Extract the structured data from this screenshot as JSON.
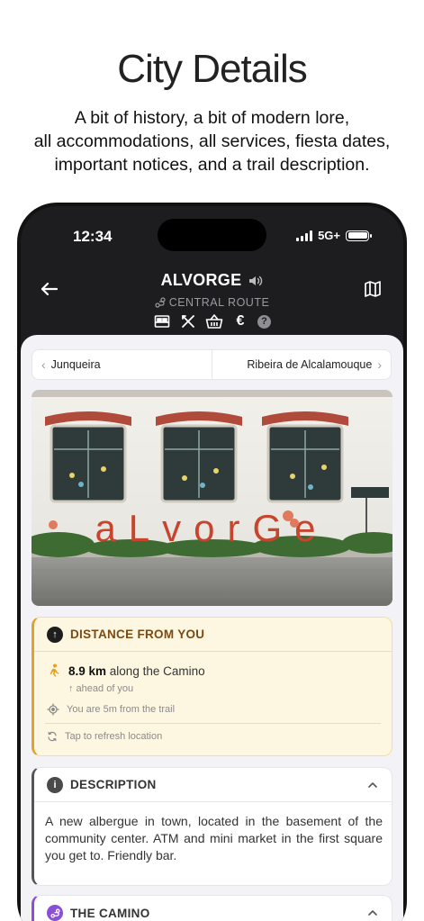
{
  "hero": {
    "title": "City Details",
    "subtitle_lines": [
      "A bit of history, a bit of modern lore,",
      "all accommodations, all services, fiesta dates,",
      "important notices, and a trail description."
    ]
  },
  "status_bar": {
    "time": "12:34",
    "network": "5G+"
  },
  "header": {
    "city_name": "ALVORGE",
    "route": "CENTRAL ROUTE",
    "services": [
      "bed-icon",
      "fork-knife-icon",
      "basket-icon",
      "euro-icon",
      "help-icon"
    ],
    "euro_symbol": "€",
    "help_symbol": "?"
  },
  "neighbors": {
    "previous": "Junqueira",
    "next": "Ribeira de Alcalamouque"
  },
  "photo": {
    "sign_text": "aLvorGe"
  },
  "distance": {
    "title": "DISTANCE FROM YOU",
    "value": "8.9 km",
    "suffix": "along the Camino",
    "direction": "↑ ahead of you",
    "trail_offset": "You are 5m from the trail",
    "refresh": "Tap to refresh location",
    "accent": "#e2a227"
  },
  "description": {
    "title": "DESCRIPTION",
    "text": "A new albergue in town, located in the basement of the community center. ATM and mini market in the first square you get to. Friendly bar."
  },
  "camino": {
    "title": "THE CAMINO",
    "accent": "#8b4fd6"
  }
}
